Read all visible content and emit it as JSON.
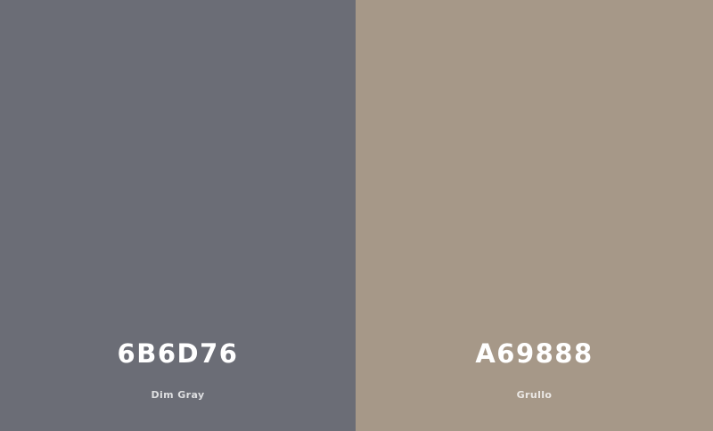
{
  "swatches": [
    {
      "hex": "6B6D76",
      "name": "Dim Gray",
      "color": "#6B6D76"
    },
    {
      "hex": "A69888",
      "name": "Grullo",
      "color": "#A69888"
    }
  ]
}
